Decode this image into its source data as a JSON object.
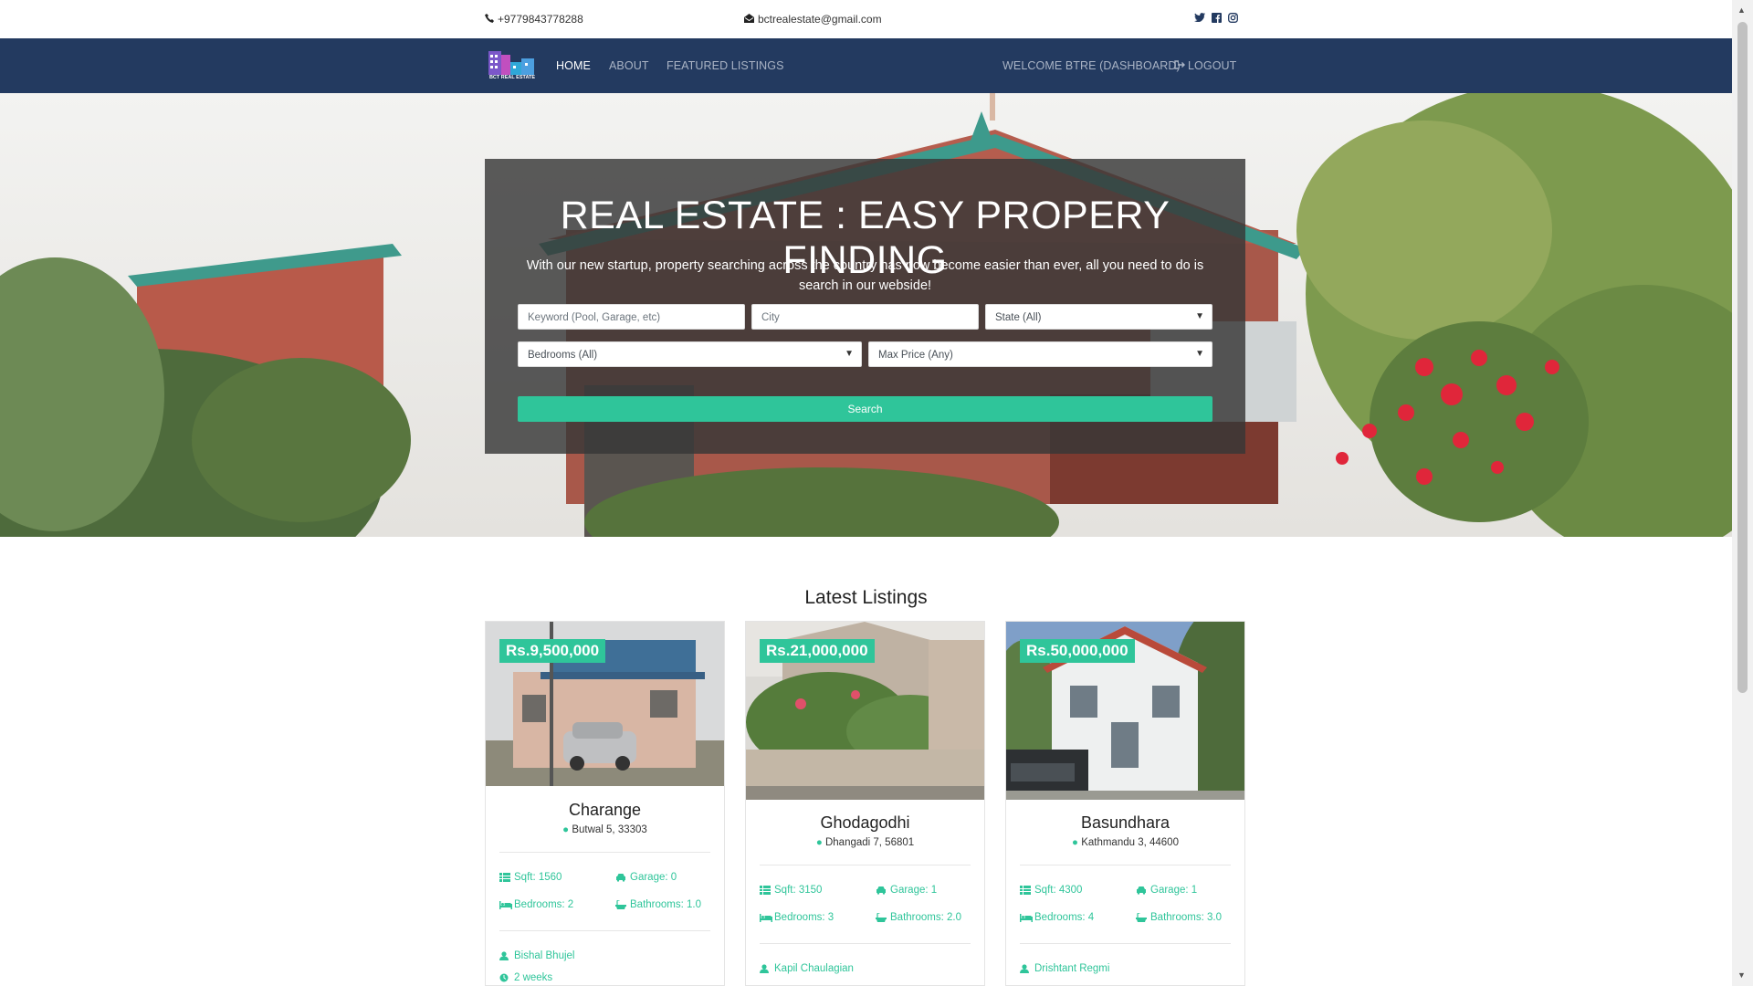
{
  "topbar": {
    "phone": "+9779843778288",
    "email": "bctrealestate@gmail.com",
    "social_icons": [
      "twitter-icon",
      "facebook-icon",
      "instagram-icon"
    ]
  },
  "navbar": {
    "logo_text": "BCT REAL ESTATE",
    "items": [
      {
        "label": "HOME",
        "active": true
      },
      {
        "label": "ABOUT",
        "active": false
      },
      {
        "label": "FEATURED LISTINGS",
        "active": false
      }
    ],
    "welcome": "WELCOME BTRE (DASHBOARD)",
    "logout": "LOGOUT"
  },
  "hero": {
    "title": "REAL ESTATE : EASY PROPERY FINDING",
    "subtitle": "With our new startup, property searching across the country has now become easier than ever, all you need to do is search in our webside!",
    "keyword_placeholder": "Keyword (Pool, Garage, etc)",
    "city_placeholder": "City",
    "state_selected": "State (All)",
    "bedrooms_selected": "Bedrooms (All)",
    "max_price_selected": "Max Price (Any)",
    "search_button": "Search"
  },
  "listings": {
    "title": "Latest Listings",
    "items": [
      {
        "price": "Rs.9,500,000",
        "name": "Charange",
        "location": "Butwal 5, 33303",
        "sqft": "Sqft: 1560",
        "garage": "Garage: 0",
        "bedrooms": "Bedrooms: 2",
        "bathrooms": "Bathrooms: 1.0",
        "realtor": "Bishal Bhujel",
        "time": "2 weeks"
      },
      {
        "price": "Rs.21,000,000",
        "name": "Ghodagodhi",
        "location": "Dhangadi 7, 56801",
        "sqft": "Sqft: 3150",
        "garage": "Garage: 1",
        "bedrooms": "Bedrooms: 3",
        "bathrooms": "Bathrooms: 2.0",
        "realtor": "Kapil Chaulagian"
      },
      {
        "price": "Rs.50,000,000",
        "name": "Basundhara",
        "location": "Kathmandu 3, 44600",
        "sqft": "Sqft: 4300",
        "garage": "Garage: 1",
        "bedrooms": "Bedrooms: 4",
        "bathrooms": "Bathrooms: 3.0",
        "realtor": "Drishtant Regmi"
      }
    ]
  },
  "colors": {
    "navbar": "#233a60",
    "accent": "#2fc59a"
  }
}
